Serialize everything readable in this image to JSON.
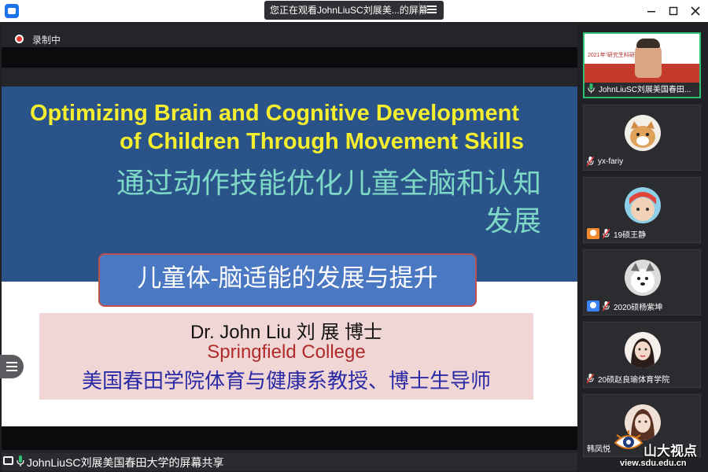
{
  "window": {
    "share_banner": "您正在观看JohnLiuSC刘展美...的屏幕",
    "controls": [
      "minimize",
      "maximize",
      "close"
    ]
  },
  "recording": {
    "label": "录制中"
  },
  "slide": {
    "title_en_line1": "Optimizing Brain and Cognitive Development",
    "title_en_line2": "of Children Through Movement Skills",
    "title_cn_line1": "通过动作技能优化儿童全脑和认知",
    "title_cn_line2": "发展",
    "subtitle": "儿童体-脑适能的发展与提升",
    "speaker_name": "Dr. John Liu 刘 展 博士",
    "speaker_org": "Springfield College",
    "speaker_title": "美国春田学院体育与健康系教授、博士生导师",
    "colors": {
      "background": "#2a5389",
      "title_en": "#f4ee2e",
      "title_cn": "#7ed8c6",
      "subtitle_box": "#4b78c2"
    }
  },
  "footer": {
    "share_status": "JohnLiuSC刘展美国春田大学的屏幕共享"
  },
  "participants": [
    {
      "name": "JohnLiuSC刘展美国春田...",
      "thumbnail_text": "2021年“研究生科研...暑期学校",
      "active": true
    },
    {
      "name": "yx-fariy"
    },
    {
      "name": "19硕王静"
    },
    {
      "name": "2020硕杨紫坤"
    },
    {
      "name": "20硕赵良瑜体育学院"
    },
    {
      "name": "韩凤悦"
    }
  ],
  "watermark": {
    "brand": "山大视点",
    "url": "view.sdu.edu.cn"
  }
}
